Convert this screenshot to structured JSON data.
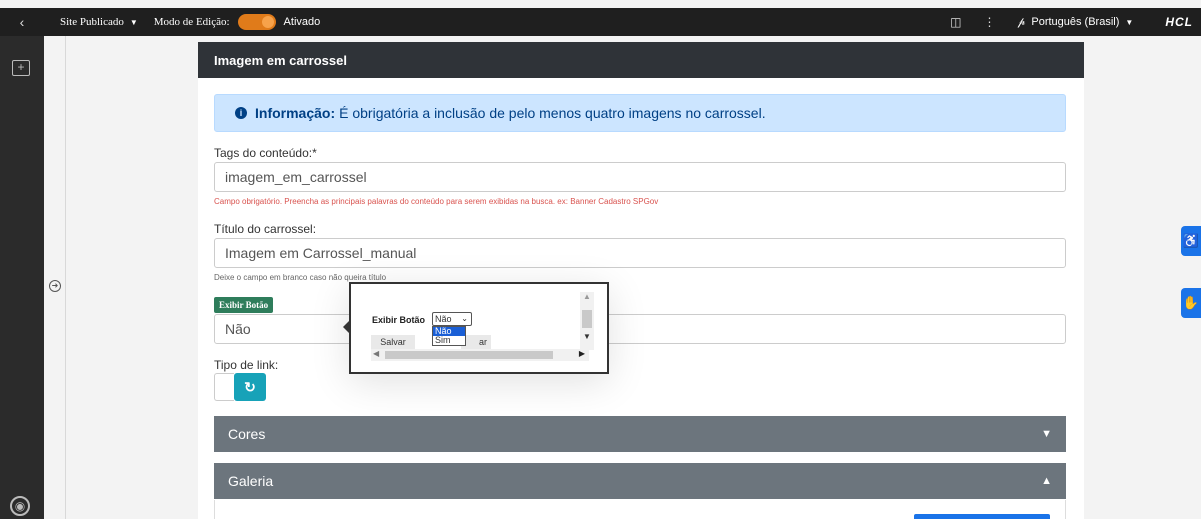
{
  "topbar": {
    "back_icon": "chevron-left-icon",
    "site_label": "Site Publicado",
    "mode_label": "Modo de Edição:",
    "mode_status": "Ativado",
    "lang_label": "Português (Brasil)",
    "logo": "HCL",
    "toggle_color": "#e07b1a"
  },
  "panel": {
    "title": "Imagem em carrossel",
    "info_bold": "Informação:",
    "info_text": "É obrigatória a inclusão de pelo menos quatro imagens no carrossel.",
    "tags_label": "Tags do conteúdo:*",
    "tags_value": "imagem_em_carrossel",
    "tags_hint": "Campo obrigatório. Preencha as principais palavras do conteúdo para serem exibidas na busca. ex: Banner Cadastro SPGov",
    "title_label": "Título do carrossel:",
    "title_value": "Imagem em Carrossel_manual",
    "title_hint": "Deixe o campo em branco caso não queira título",
    "show_button_tag": "Exibir Botão",
    "show_button_value": "Não",
    "link_type_label": "Tipo de link:",
    "refresh_icon": "refresh-icon",
    "accordion_colors": "Cores",
    "accordion_gallery": "Galeria"
  },
  "popup": {
    "label": "Exibir Botão",
    "select_value": "Não",
    "options": [
      "Não",
      "Sim"
    ],
    "save_label": "Salvar",
    "second_label": "ar"
  },
  "colors": {
    "accent": "#1a73e8",
    "header": "#2f3338",
    "accordion": "#6c757d",
    "info_bg": "#cce5ff",
    "tag_green": "#2e7d5b",
    "refresh_btn": "#17a2b8"
  }
}
